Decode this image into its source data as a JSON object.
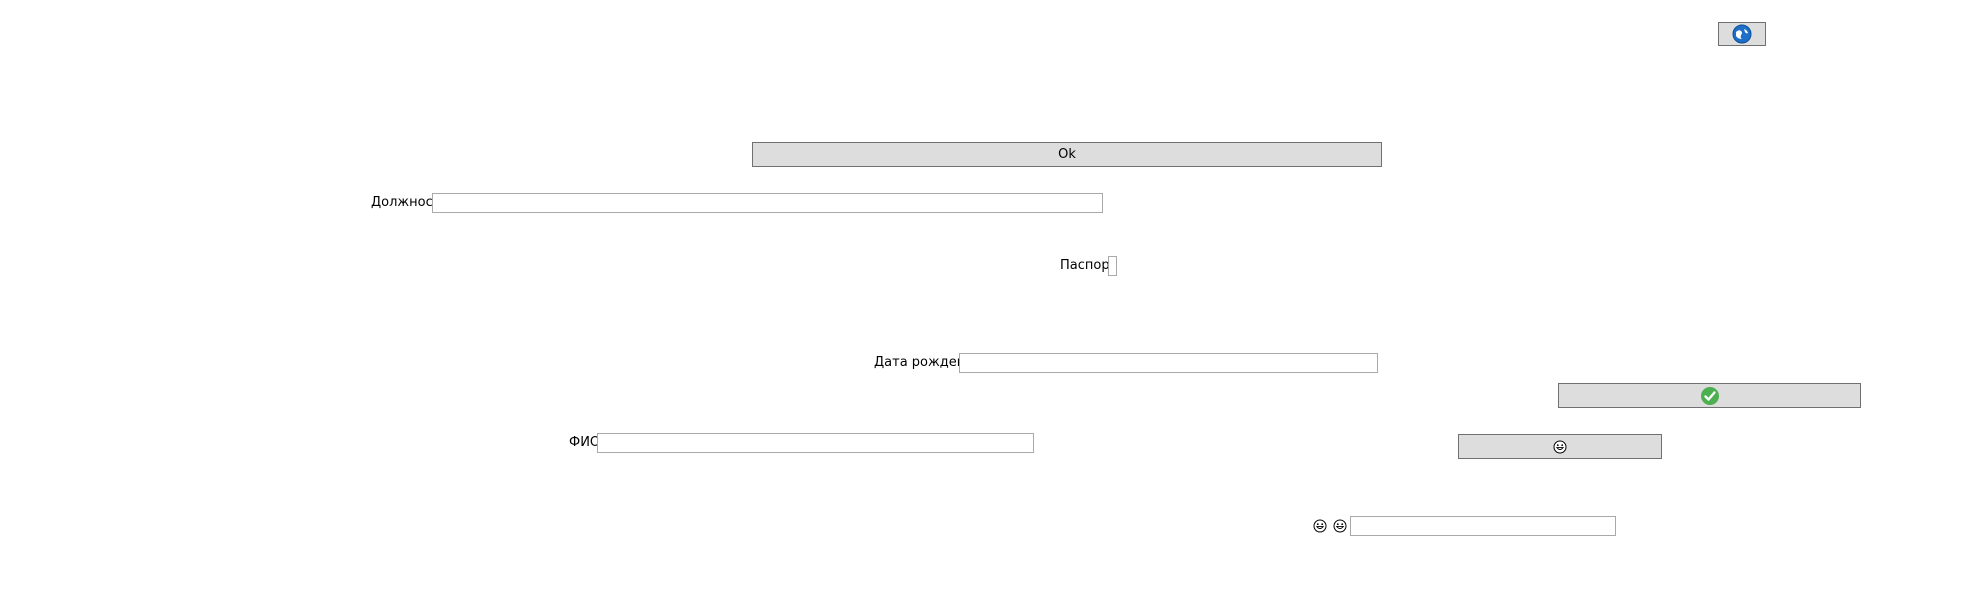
{
  "window": {
    "background": "#ffffff"
  },
  "buttons": {
    "ok_label": "Ok",
    "top_icon": "globe-icon",
    "check_icon": "check-circle-icon",
    "emoji_icon": "grinning-face-icon"
  },
  "form": {
    "position_label": "Должность",
    "position_value": "",
    "passport_label": "Паспорт",
    "birthdate_label": "Дата рождения",
    "birthdate_value": "",
    "fio_label": "ФИО",
    "fio_value": "",
    "emoji_field_value": ""
  },
  "colors": {
    "button_bg": "#dddddd",
    "button_border": "#707070",
    "input_border": "#a9a9a9",
    "check_green": "#4caf50",
    "globe_blue": "#1e6fc8"
  }
}
